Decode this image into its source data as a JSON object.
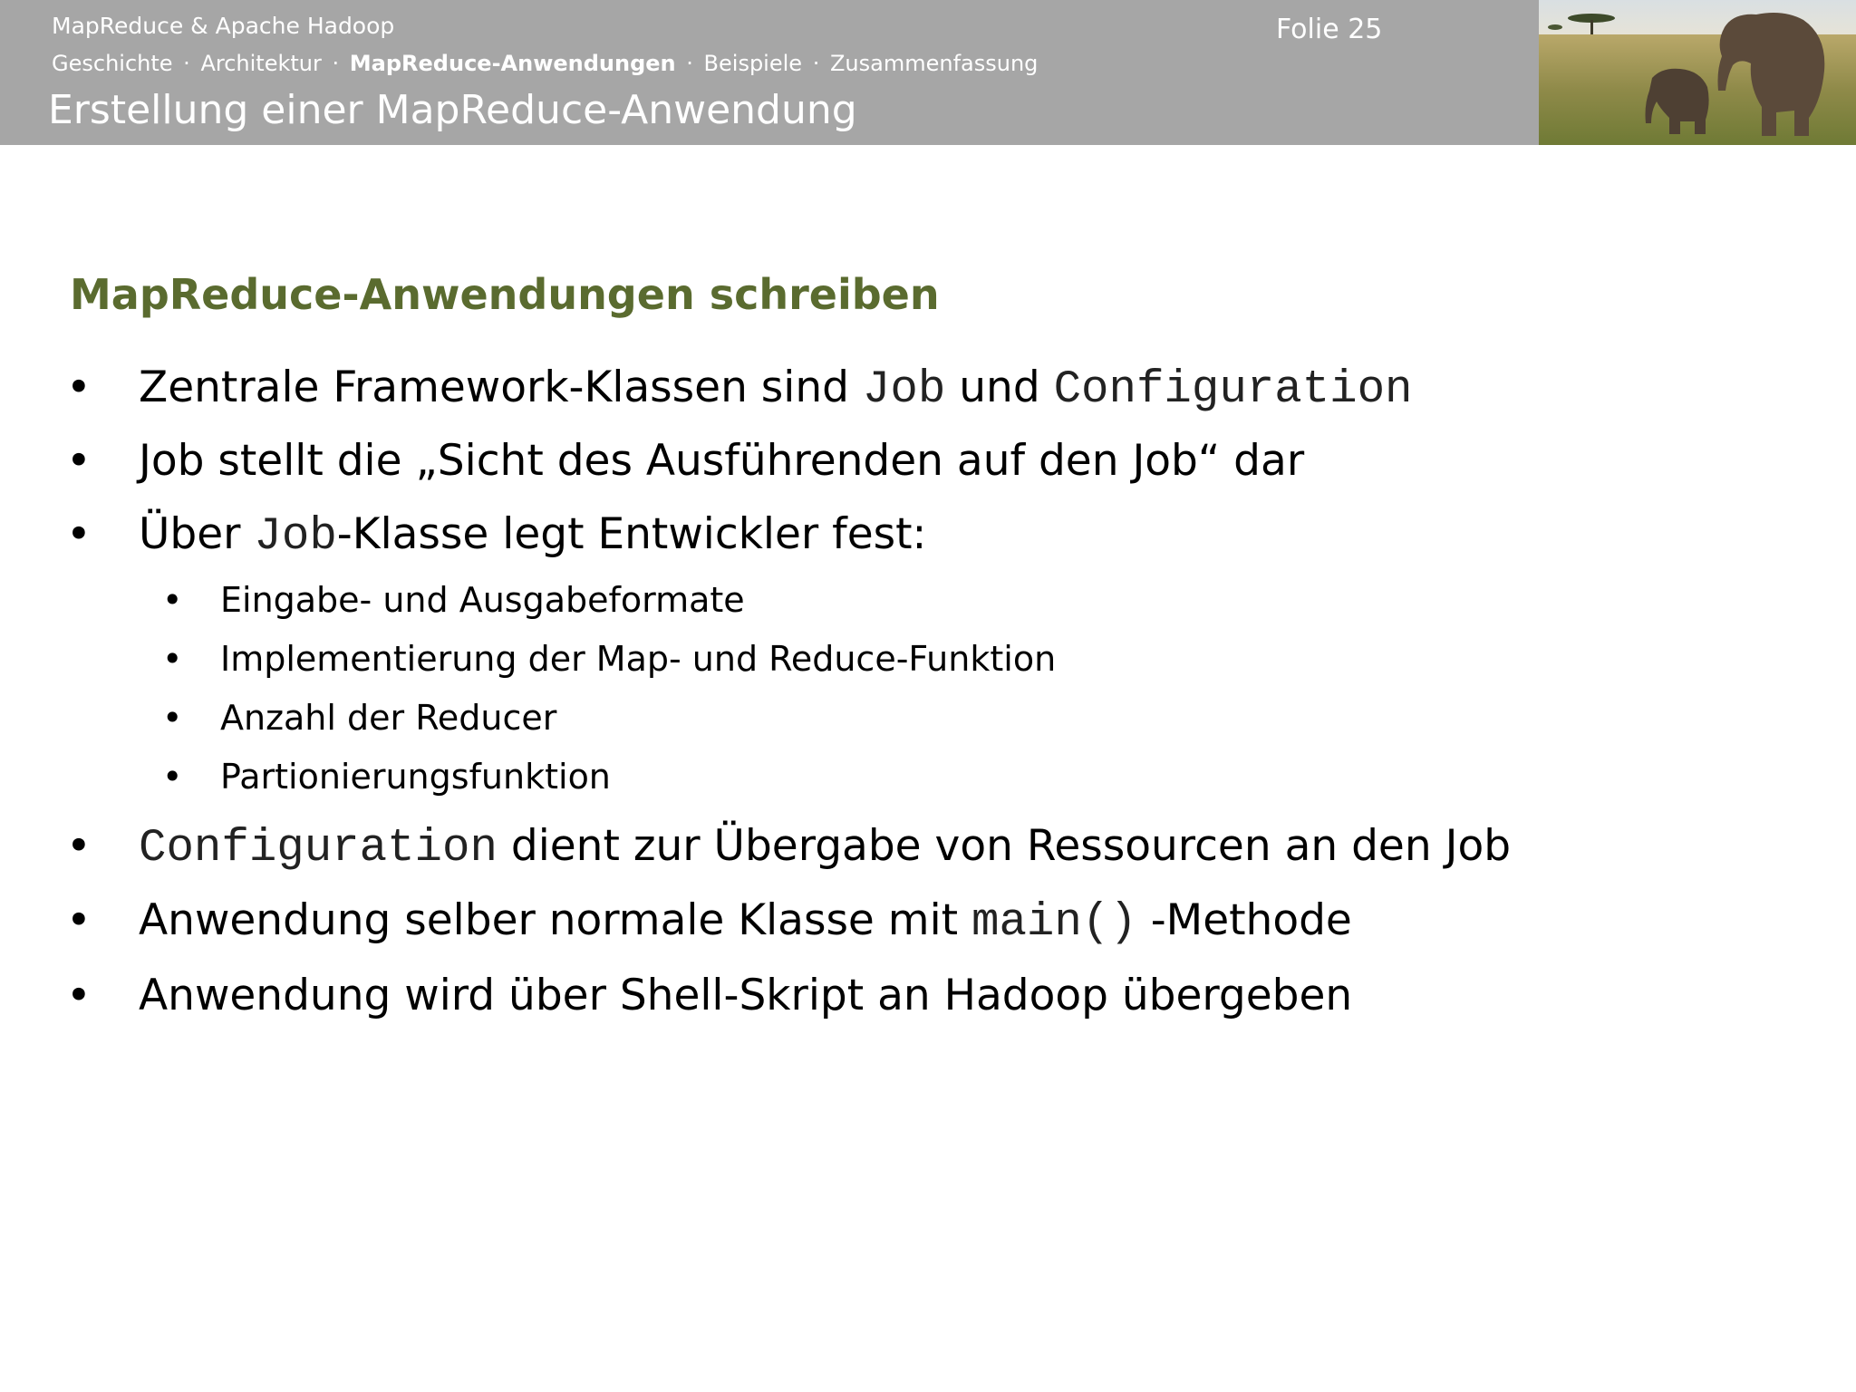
{
  "header": {
    "course": "MapReduce & Apache Hadoop",
    "breadcrumb": {
      "items": [
        "Geschichte",
        "Architektur",
        "MapReduce-Anwendungen",
        "Beispiele",
        "Zusammenfassung"
      ],
      "separator": "·",
      "active": "MapReduce-Anwendungen"
    },
    "title": "Erstellung einer MapReduce-Anwendung",
    "slide_number": "Folie 25",
    "photo_icon": "elephants-savanna-photo"
  },
  "content": {
    "heading": "MapReduce-Anwendungen schreiben",
    "bullet_char": "•",
    "heading_color": "#5a6b2f",
    "bullets": [
      {
        "a": "Zentrale Framework-Klassen sind ",
        "b": "Job",
        "c": " und ",
        "d": "Configuration"
      },
      {
        "a": "Job stellt die „Sicht des Ausführenden auf den Job“ dar"
      },
      {
        "a": "Über ",
        "b": "Job",
        "c": "-Klasse legt Entwickler fest:"
      },
      {
        "a": "Configuration",
        "b": " dient zur Übergabe von Ressourcen an den Job"
      },
      {
        "a": "Anwendung selber normale Klasse mit ",
        "b": "main()",
        "c": " -Methode"
      },
      {
        "a": "Anwendung wird über Shell-Skript an Hadoop übergeben"
      }
    ],
    "sub_bullets": [
      "Eingabe- und Ausgabeformate",
      "Implementierung der Map- und Reduce-Funktion",
      "Anzahl der Reducer",
      "Partionierungsfunktion"
    ]
  }
}
